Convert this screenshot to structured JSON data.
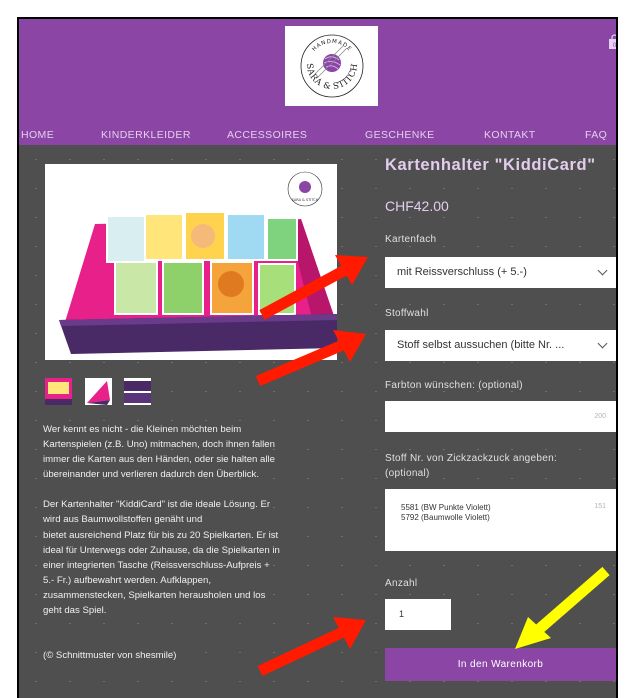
{
  "colors": {
    "brand": "#8a45a5",
    "page_bg": "#4f4f4f",
    "title": "#e3cdee",
    "arrow_red": "#ff1a00",
    "arrow_yellow": "#ffff00"
  },
  "logo": {
    "line1": "HANDMADE",
    "line2": "SARA & STITCH"
  },
  "cart": {
    "count": "0",
    "icon": "shopping-bag-icon"
  },
  "nav": {
    "items": [
      "HOME",
      "KINDERKLEIDER",
      "ACCESSOIRES",
      "GESCHENKE",
      "KONTAKT",
      "FAQ"
    ]
  },
  "product": {
    "title": "Kartenhalter \"KiddiCard\"",
    "price": "CHF42.00",
    "image_logo": "SARA & STITCH"
  },
  "options": {
    "kartenfach": {
      "label": "Kartenfach",
      "value": "mit Reissverschluss (+ 5.-)"
    },
    "stoffwahl": {
      "label": "Stoffwahl",
      "value": "Stoff selbst aussuchen (bitte Nr. ..."
    },
    "farbton": {
      "label": "Farbton wünschen: (optional)",
      "value": "",
      "counter": "200"
    },
    "stoff_nr": {
      "label_line1": "Stoff Nr. von Zickzackzuck angeben:",
      "label_line2": "(optional)",
      "line1": "5581 (BW Punkte Violett)",
      "line2": "5792 (Baumwolle Violett)",
      "counter": "151"
    },
    "anzahl": {
      "label": "Anzahl",
      "value": "1"
    }
  },
  "add_to_cart": "In den Warenkorb",
  "description": {
    "para1": [
      "Wer kennt es nicht - die Kleinen möchten beim",
      "Kartenspielen (z.B. Uno) mitmachen, doch ihnen fallen",
      "immer die Karten aus den Händen, oder sie halten alle",
      "übereinander und verlieren dadurch den Überblick."
    ],
    "para2": [
      "Der Kartenhalter \"KiddiCard\" ist die ideale Lösung. Er",
      "wird aus Baumwollstoffen genäht und",
      "bietet ausreichend Platz für bis zu 20 Spielkarten. Er ist",
      "ideal für Unterwegs oder Zuhause, da die Spielkarten in",
      "einer integrierten Tasche (Reissverschluss-Aufpreis +",
      "5.- Fr.) aufbewahrt werden. Aufklappen,",
      "zusammenstecken, Spielkarten herausholen und los",
      "geht das Spiel."
    ],
    "para3": "(© Schnittmuster von shesmile)"
  }
}
